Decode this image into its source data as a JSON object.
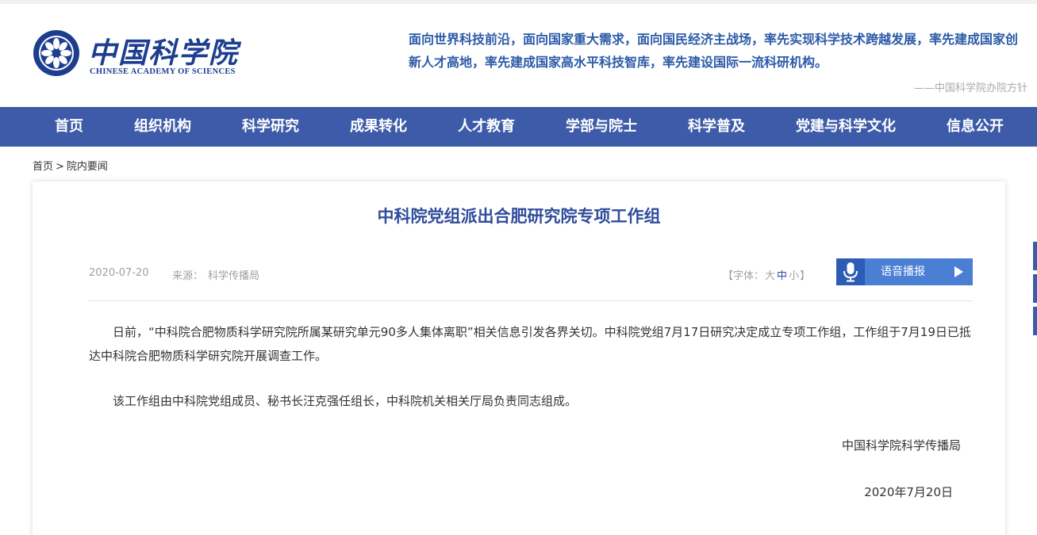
{
  "header": {
    "logo_cn": "中国科学院",
    "logo_en": "CHINESE ACADEMY OF SCIENCES",
    "motto": "面向世界科技前沿，面向国家重大需求，面向国民经济主战场，率先实现科学技术跨越发展，率先建成国家创新人才高地，率先建成国家高水平科技智库，率先建设国际一流科研机构。",
    "motto_signature": "——中国科学院办院方针"
  },
  "nav": {
    "items": [
      "首页",
      "组织机构",
      "科学研究",
      "成果转化",
      "人才教育",
      "学部与院士",
      "科学普及",
      "党建与科学文化",
      "信息公开"
    ]
  },
  "breadcrumb": {
    "home": "首页",
    "separator": ">",
    "current": "院内要闻"
  },
  "article": {
    "title": "中科院党组派出合肥研究院专项工作组",
    "date": "2020-07-20",
    "source_label": "来源：",
    "source_value": "科学传播局",
    "font_size": {
      "open": "【字体：",
      "large": "大",
      "medium": "中",
      "small": "小",
      "close": "】"
    },
    "voice_label": "语音播报",
    "paragraphs": [
      "日前，“中科院合肥物质科学研究院所属某研究单元90多人集体离职”相关信息引发各界关切。中科院党组7月17日研究决定成立专项工作组，工作组于7月19日已抵达中科院合肥物质科学研究院开展调查工作。",
      "该工作组由中科院党组成员、秘书长汪克强任组长，中科院机关相关厅局负责同志组成。"
    ],
    "signature": "中国科学院科学传播局",
    "signature_date": "2020年7月20日"
  },
  "colors": {
    "nav_bg": "#3d5ba9",
    "title": "#2f4c9c",
    "motto": "#2b5aa8",
    "voice_button": "#4a7fd4"
  }
}
